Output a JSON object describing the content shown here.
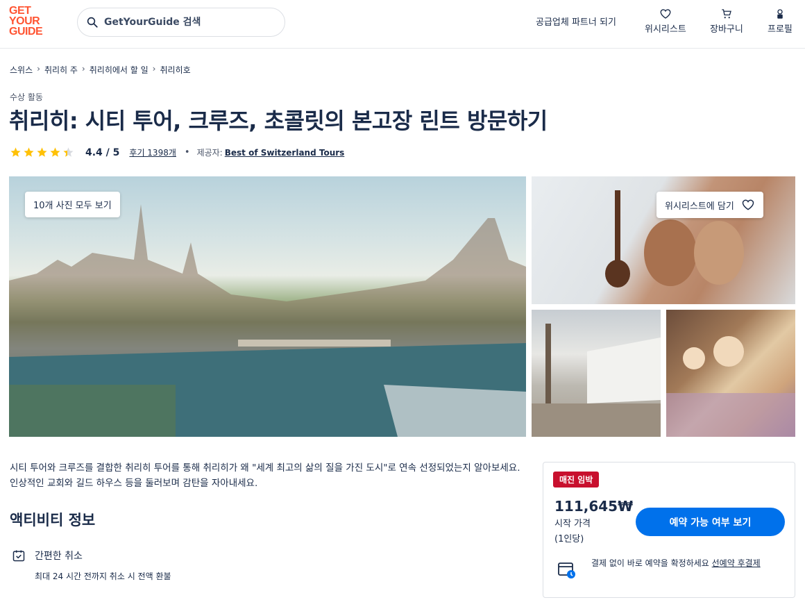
{
  "header": {
    "logo": [
      "GET",
      "YOUR",
      "GUIDE"
    ],
    "search_placeholder": "GetYourGuide 검색",
    "partner_link": "공급업체 파트너 되기",
    "wishlist": "위시리스트",
    "cart": "장바구니",
    "profile": "프로필"
  },
  "breadcrumb": [
    "스위스",
    "취리히 주",
    "취리히에서 할 일",
    "취리히호"
  ],
  "activity": {
    "category": "수상 활동",
    "title": "취리히: 시티 투어, 크루즈, 초콜릿의 본고장 린트 방문하기",
    "rating": "4.4 / 5",
    "rating_value": 4.4,
    "reviews": "후기 1398개",
    "provider_label": "제공자:",
    "provider": "Best of Switzerland Tours"
  },
  "gallery": {
    "view_all": "10개 사진 모두 보기",
    "add_wishlist": "위시리스트에 담기"
  },
  "description": "시티 투어와 크루즈를 결합한 취리히 투어를 통해 취리히가 왜 \"세계 최고의 삶의 질을 가진 도시\"로 연속 선정되었는지 알아보세요. 인상적인 교회와 길드 하우스 등을 둘러보며 감탄을 자아내세요.",
  "info": {
    "section_title": "액티비티 정보",
    "free_cancel_title": "간편한 취소",
    "free_cancel_sub": "최대 24 시간 전까지 취소 시 전액 환불"
  },
  "booking": {
    "badge": "매진 임박",
    "price": "111,645₩",
    "price_label": "시작 가격",
    "price_per": "(1인당)",
    "cta": "예약 가능 여부 보기",
    "rnpl_text": "결제 없이 바로 예약을 확정하세요 ",
    "rnpl_link": "선예약 후결제"
  },
  "colors": {
    "brand": "#ff5533",
    "primary": "#0071eb",
    "badge": "#c8102e",
    "star": "#ffc107",
    "text": "#1a2b49"
  }
}
